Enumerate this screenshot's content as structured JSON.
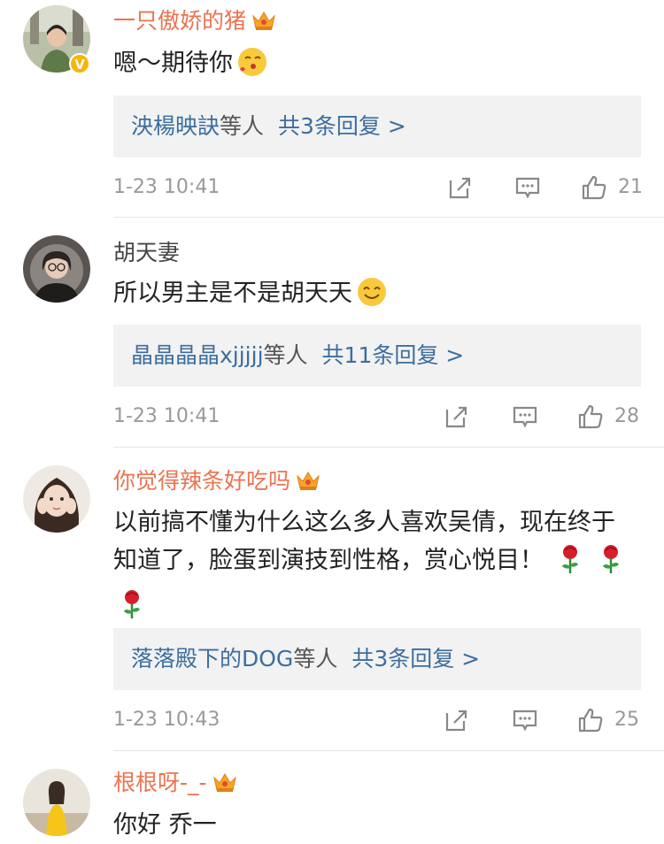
{
  "comments": [
    {
      "username": "一只傲娇的猪",
      "text": "嗯～期待你",
      "replies_users": "泱楊映訣",
      "replies_suffix": "等人",
      "replies_count": "共3条回复 >",
      "time": "1-23 10:41",
      "likes": "21",
      "verified_badge": "V"
    },
    {
      "username": "胡天妻",
      "text": "所以男主是不是胡天天",
      "replies_users": "晶晶晶晶xjjjjj",
      "replies_suffix": "等人",
      "replies_count": "共11条回复 >",
      "time": "1-23 10:41",
      "likes": "28"
    },
    {
      "username": "你觉得辣条好吃吗",
      "text": "以前搞不懂为什么这么多人喜欢吴倩，现在终于知道了，脸蛋到演技到性格，赏心悦目！",
      "replies_users": "落落殿下的DOG",
      "replies_suffix": "等人",
      "replies_count": "共3条回复 >",
      "time": "1-23 10:43",
      "likes": "25"
    },
    {
      "username": "根根呀-_-",
      "text": "你好 乔一"
    }
  ],
  "icons": {
    "share": "share-icon",
    "comment": "comment-icon",
    "like": "like-icon",
    "crown": "vip-crown-icon",
    "rose": "rose-emoji-icon"
  },
  "colors": {
    "vip_name": "#eb7350",
    "link": "#3c6e9e",
    "meta": "#999999",
    "reply_bg": "#f2f2f2",
    "badge": "#f7b500"
  }
}
